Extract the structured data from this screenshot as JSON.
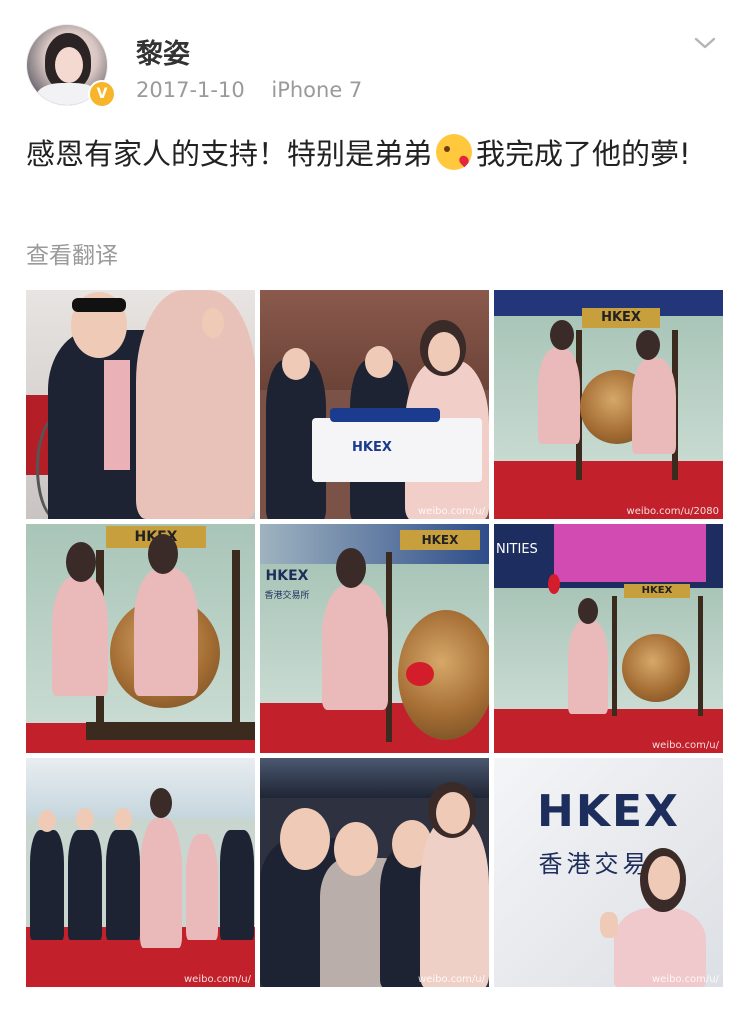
{
  "post": {
    "username": "黎姿",
    "verified_badge": "V",
    "date": "2017-1-10",
    "device": "iPhone 7",
    "text_before_emoji": "感恩有家人的支持！特别是弟弟",
    "text_after_emoji": "我完成了他的夢!",
    "emoji": "kissing-face-heart-emoji",
    "translate_label": "查看翻译"
  },
  "photos": [
    {
      "alt": "photo-1",
      "watermark": ""
    },
    {
      "alt": "photo-2",
      "watermark": "weibo.com/u/"
    },
    {
      "alt": "photo-3",
      "watermark": "weibo.com/u/2080",
      "sign": "HKEX"
    },
    {
      "alt": "photo-4",
      "watermark": "",
      "sign": "HKEX"
    },
    {
      "alt": "photo-5",
      "watermark": "",
      "sign": "HKEX",
      "wall": "HKEX",
      "wall_sub": "香港交易所"
    },
    {
      "alt": "photo-6",
      "watermark": "weibo.com/u/",
      "wall": "NITIES"
    },
    {
      "alt": "photo-7",
      "watermark": "weibo.com/u/"
    },
    {
      "alt": "photo-8",
      "watermark": "weibo.com/u/"
    },
    {
      "alt": "photo-9",
      "watermark": "weibo.com/u/",
      "wall": "HKEX",
      "wall_sub": "香港交易所"
    }
  ],
  "colors": {
    "meta_gray": "#9a9a9a",
    "badge": "#f7b52b",
    "red_carpet": "#c2202a",
    "pink_suit": "#eab9b9",
    "hkex_navy": "#1e2e5c"
  }
}
